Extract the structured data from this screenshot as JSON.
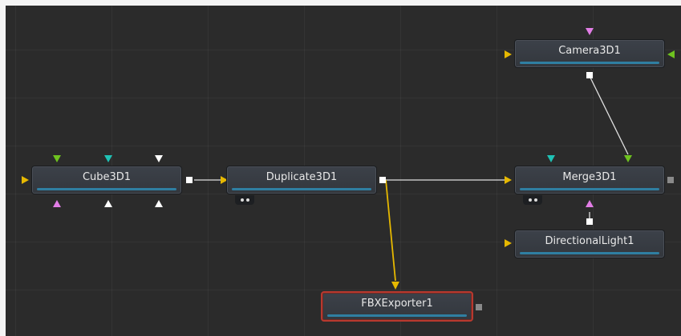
{
  "nodes": {
    "cube": {
      "label": "Cube3D1"
    },
    "duplicate": {
      "label": "Duplicate3D1"
    },
    "camera": {
      "label": "Camera3D1"
    },
    "merge": {
      "label": "Merge3D1"
    },
    "light": {
      "label": "DirectionalLight1"
    },
    "fbx": {
      "label": "FBXExporter1"
    }
  },
  "colors": {
    "canvas_bg": "#2b2b2b",
    "node_bar": "#2f7fa2",
    "wire_white": "#e0e0e0",
    "wire_yellow": "#e6b800",
    "input_yellow": "#e6b800",
    "input_green": "#6ec21f",
    "input_pink": "#e27de6",
    "input_teal": "#1fc2b5",
    "input_white": "#ffffff",
    "selected_border": "#b8392f"
  }
}
